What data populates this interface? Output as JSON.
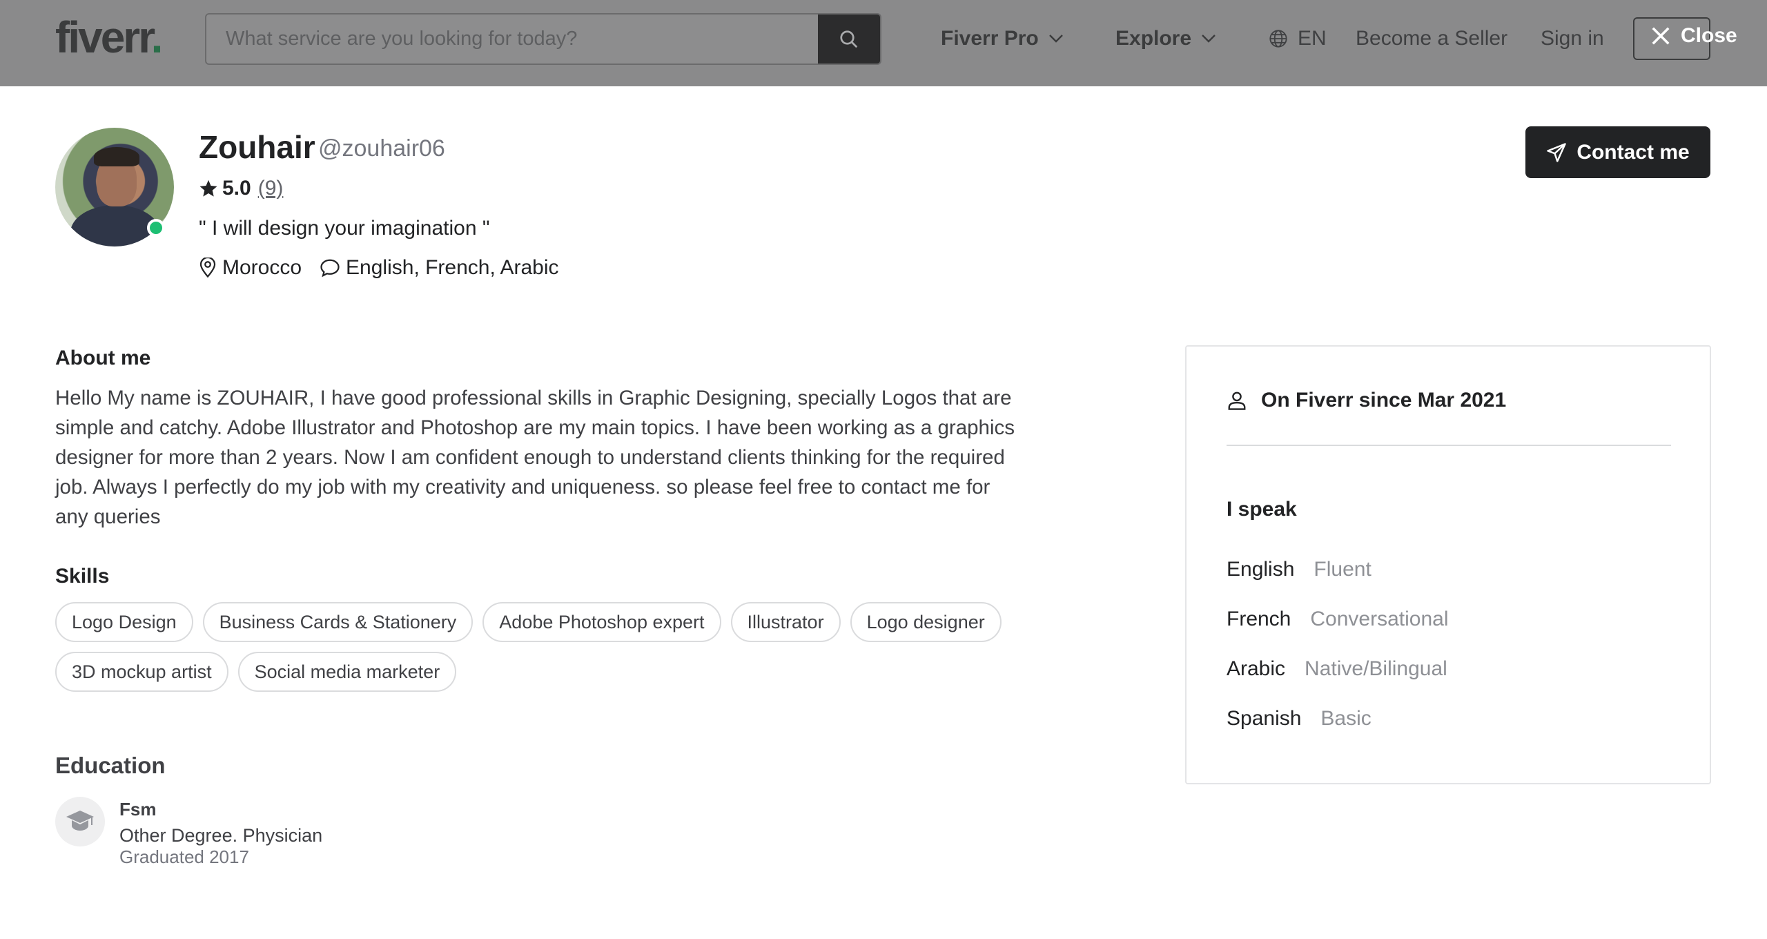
{
  "header": {
    "logo_text": "fiverr",
    "logo_dot": ".",
    "search_placeholder": "What service are you looking for today?",
    "nav": {
      "fiverr_pro": "Fiverr Pro",
      "explore": "Explore",
      "language": "EN",
      "become_seller": "Become a Seller",
      "sign_in": "Sign in"
    },
    "close_label": "Close"
  },
  "profile": {
    "name": "Zouhair",
    "username": "@zouhair06",
    "rating": "5.0",
    "review_count": "(9)",
    "tagline": "\" I will design your imagination \"",
    "location": "Morocco",
    "languages_summary": "English, French, Arabic",
    "contact_label": "Contact me"
  },
  "about": {
    "title": "About me",
    "text": "Hello My name is ZOUHAIR, I have good professional skills in Graphic Designing, specially Logos that are simple and catchy. Adobe Illustrator and Photoshop are my main topics. I have been working as a graphics designer for more than 2 years. Now I am confident enough to understand clients thinking for the required job. Always I perfectly do my job with my creativity and uniqueness. so please feel free to contact me for any queries"
  },
  "skills": {
    "title": "Skills",
    "items": [
      "Logo Design",
      "Business Cards & Stationery",
      "Adobe Photoshop expert",
      "Illustrator",
      "Logo designer",
      "3D mockup artist",
      "Social media marketer"
    ]
  },
  "education": {
    "title": "Education",
    "school": "Fsm",
    "degree": "Other Degree. Physician",
    "graduated": "Graduated 2017"
  },
  "sidebar_card": {
    "member_since": "On Fiverr since Mar 2021",
    "speak_title": "I speak",
    "languages": [
      {
        "name": "English",
        "level": "Fluent"
      },
      {
        "name": "French",
        "level": "Conversational"
      },
      {
        "name": "Arabic",
        "level": "Native/Bilingual"
      },
      {
        "name": "Spanish",
        "level": "Basic"
      }
    ]
  },
  "colors": {
    "online": "#1dbf73",
    "button_dark": "#222325",
    "overlay_header": "#8a8a8b"
  }
}
